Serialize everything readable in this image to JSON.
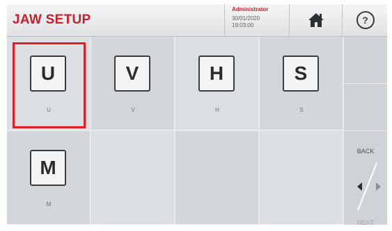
{
  "header": {
    "title": "JAW SETUP",
    "user_role": "Administrator",
    "date": "30/01/2020",
    "time": "19:03:00",
    "home_icon": "home-icon",
    "help_symbol": "?"
  },
  "jaws": [
    {
      "letter": "U",
      "label": "U",
      "selected": true
    },
    {
      "letter": "V",
      "label": "V",
      "selected": false
    },
    {
      "letter": "H",
      "label": "H",
      "selected": false
    },
    {
      "letter": "S",
      "label": "S",
      "selected": false
    },
    {
      "letter": "M",
      "label": "M",
      "selected": false
    }
  ],
  "side_nav": {
    "back_label": "BACK",
    "next_label": "NEXT"
  },
  "colors": {
    "accent": "#c9202c",
    "selection": "#e31b23"
  }
}
